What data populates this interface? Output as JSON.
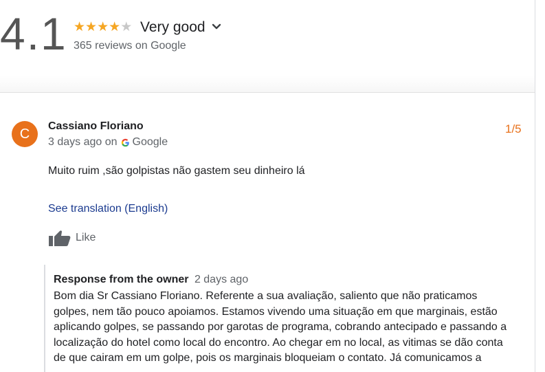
{
  "header": {
    "score": "4.1",
    "stars_filled": 4,
    "stars_total": 5,
    "summary_label": "Very good",
    "review_count_text": "365 reviews on Google"
  },
  "review": {
    "avatar_letter": "C",
    "avatar_color": "#e8711b",
    "reviewer_name": "Cassiano Floriano",
    "date_text": "3 days ago on",
    "source_label": "Google",
    "score": "1/5",
    "text": "Muito ruim ,são golpistas não gastem seu dinheiro lá",
    "translate_link": "See translation (English)",
    "like_label": "Like"
  },
  "owner_response": {
    "title": "Response from the owner",
    "date": "2 days ago",
    "lines": [
      "Bom dia Sr Cassiano Floriano. Referente a sua avaliação, saliento que não praticamos",
      "golpes, nem tão pouco apoiamos. Estamos vivendo uma situação em que marginais, estão",
      "aplicando golpes, se passando por garotas de programa, cobrando antecipado e passando a",
      "localização do hotel como local do encontro. Ao chegar em no local, as vitimas se dão conta",
      "de que cairam em um golpe, pois os marginais bloqueiam o contato. Já comunicamos a"
    ]
  },
  "colors": {
    "star": "#f5a623",
    "accent_orange": "#e8711b",
    "link_blue": "#1a3a8f"
  },
  "icons": [
    "chevron-down-icon",
    "google-g-icon",
    "thumbs-up-icon"
  ]
}
